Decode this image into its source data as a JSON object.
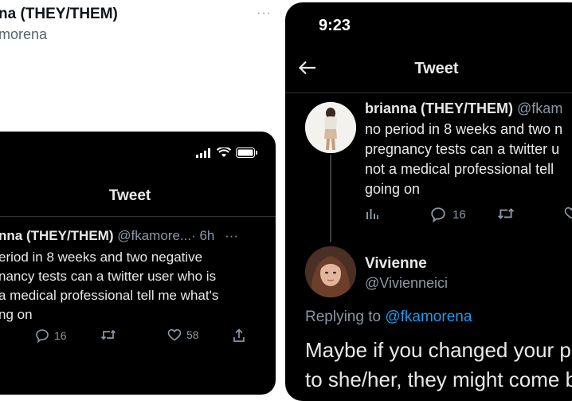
{
  "background_tweet": {
    "name_fragment": "na (THEY/THEM)",
    "handle_fragment": "morena",
    "more_glyph": "···"
  },
  "left_phone": {
    "title": "Tweet",
    "author_name": "nna (THEY/THEM)",
    "author_handle": "@fkamore...",
    "author_time": "· 6h",
    "more_glyph": "···",
    "text": "eriod in 8 weeks and two negative nancy tests can a twitter user who is a medical professional tell me what's ng on",
    "text_lines": [
      "eriod in 8 weeks and two negative",
      "nancy tests can a twitter user who is",
      "a medical professional tell me what's",
      "ng on"
    ],
    "replies": "16",
    "likes": "58"
  },
  "right_phone": {
    "time": "9:23",
    "title": "Tweet",
    "original_tweet": {
      "author_name": "brianna (THEY/THEM)",
      "author_handle": "@fkam",
      "text_lines": [
        "no period in 8 weeks and two n",
        "pregnancy tests can a twitter u",
        "not a medical professional tell",
        "going on"
      ],
      "replies": "16"
    },
    "reply_tweet": {
      "author_name": "Vivienne",
      "author_handle": "@Vivienneici",
      "replying_prefix": "Replying to",
      "replying_handle": "@fkamorena",
      "text_lines": [
        "Maybe if you changed your p",
        "to she/her, they might come b"
      ]
    }
  },
  "colors": {
    "dark_bg": "#000000",
    "text_primary": "#e7e9ea",
    "text_secondary": "#8b98a5",
    "link": "#1d9bf0",
    "divider": "#2f3336"
  }
}
